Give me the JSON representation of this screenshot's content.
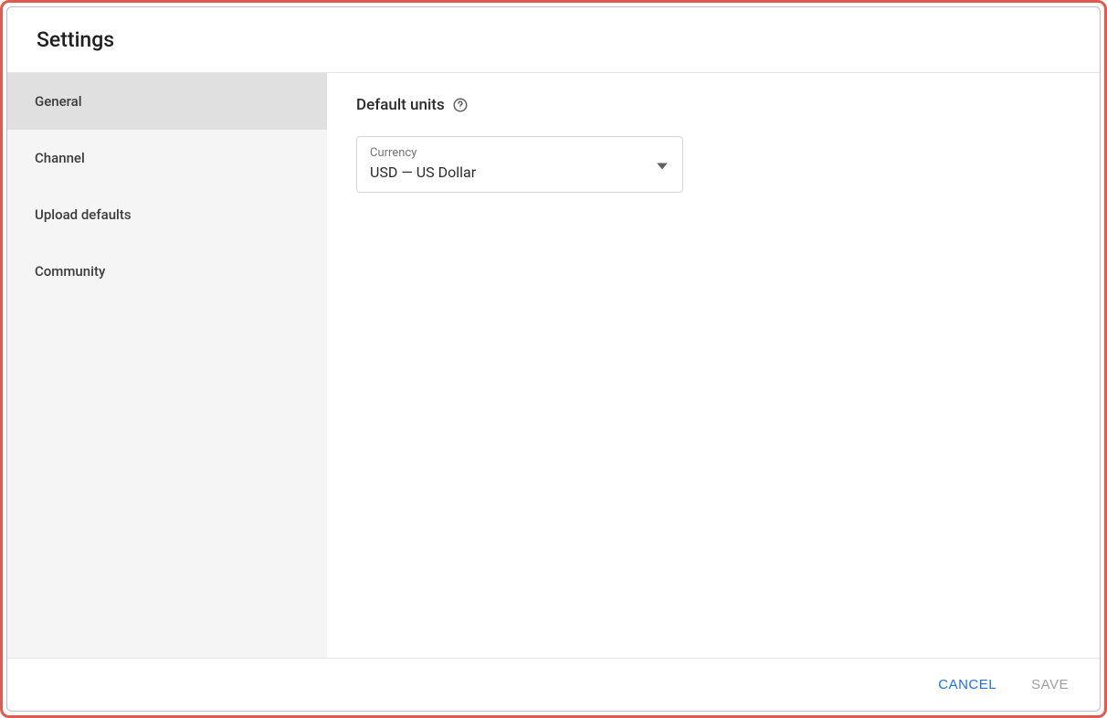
{
  "dialog": {
    "title": "Settings"
  },
  "sidebar": {
    "items": [
      {
        "label": "General",
        "active": true
      },
      {
        "label": "Channel",
        "active": false
      },
      {
        "label": "Upload defaults",
        "active": false
      },
      {
        "label": "Community",
        "active": false
      }
    ]
  },
  "main": {
    "section_title": "Default units",
    "help_icon": "help-outline-icon",
    "currency_field": {
      "label": "Currency",
      "value": "USD — US Dollar"
    }
  },
  "footer": {
    "cancel_label": "CANCEL",
    "save_label": "SAVE"
  }
}
